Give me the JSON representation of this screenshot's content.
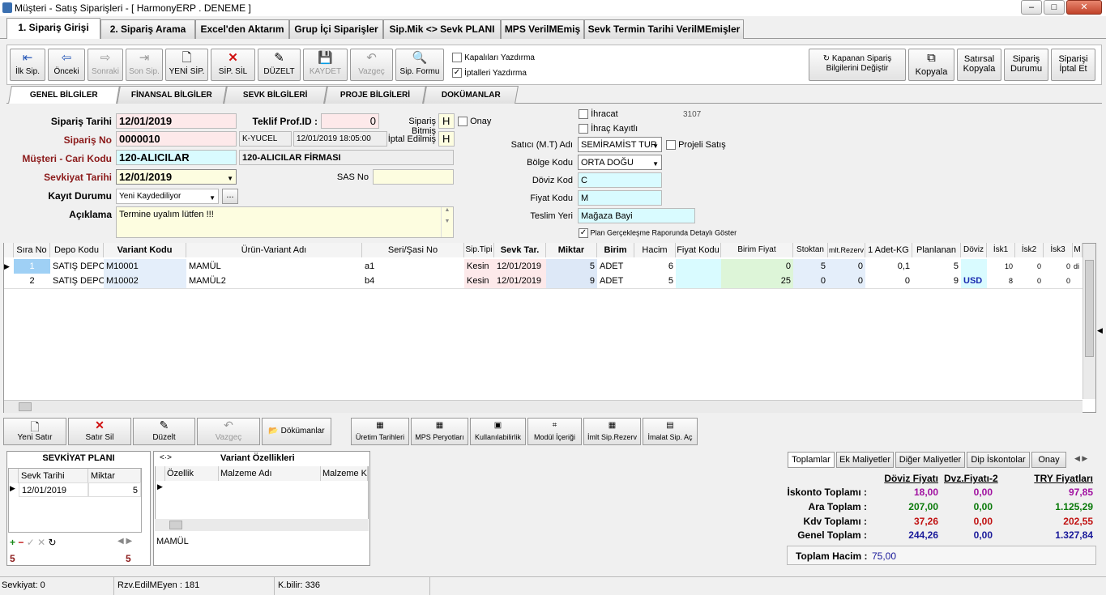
{
  "window": {
    "title": "Müşteri - Satış Siparişleri - [ HarmonyERP . DENEME ]",
    "min": "–",
    "max": "□",
    "close": "✕"
  },
  "main_tabs": [
    "1. Sipariş Girişi",
    "2. Sipariş Arama",
    "Excel'den Aktarım",
    "Grup İçi Siparişler",
    "Sip.Mik <> Sevk PLANI",
    "MPS VerilMEmiş",
    "Sevk Termin Tarihi VerilMEmişler"
  ],
  "toolbar": {
    "first": "İlk Sip.",
    "prev": "Önceki",
    "next": "Sonraki",
    "last": "Son Sip.",
    "new": "YENİ SİP.",
    "delete": "SİP. SİL",
    "edit": "DÜZELT",
    "save": "KAYDET",
    "cancel": "Vazgeç",
    "form": "Sip. Formu",
    "print_closed": "Kapalıları Yazdırma",
    "print_cancelled": "İptalleri Yazdırma",
    "change_closed": "Kapanan Sipariş Bilgilerini Değiştir",
    "copy": "Kopyala",
    "row_copy": "Satırsal Kopyala",
    "order_status": "Sipariş Durumu",
    "cancel_order": "Siparişi İptal Et"
  },
  "sub_tabs": [
    "GENEL BİLGİLER",
    "FİNANSAL BİLGİLER",
    "SEVK BİLGİLERİ",
    "PROJE BİLGİLERİ",
    "DOKÜMANLAR"
  ],
  "form": {
    "order_date_label": "Sipariş Tarihi",
    "order_date": "12/01/2019",
    "order_no_label": "Sipariş No",
    "order_no": "0000010",
    "customer_label": "Müşteri - Cari Kodu",
    "customer_code": "120-ALICILAR",
    "customer_name": "120-ALICILAR FİRMASI",
    "ship_date_label": "Sevkiyat Tarihi",
    "ship_date": "12/01/2019",
    "record_status_label": "Kayıt Durumu",
    "record_status": "Yeni Kaydediliyor",
    "note_label": "Açıklama",
    "note": "Termine uyalım lütfen !!!",
    "offer_label": "Teklif Prof.ID :",
    "offer_id": "0",
    "user": "K-YUCEL",
    "timestamp": "12/01/2019 18:05:00",
    "finished_label": "Sipariş Bitmiş",
    "finished": "H",
    "cancelled_label": "İptal Edilmiş",
    "cancelled": "H",
    "approve_label": "Onay",
    "sas_label": "SAS No",
    "export_label": "İhracat",
    "export_reg_label": "İhraç Kayıtlı",
    "code_3107": "3107",
    "seller_label": "Satıcı (M.T) Adı",
    "seller": "SEMİRAMİST TUR",
    "project_sale_label": "Projeli Satış",
    "region_label": "Bölge Kodu",
    "region": "ORTA DOĞU",
    "currency_label": "Döviz Kod",
    "currency": "C",
    "price_label": "Fiyat Kodu",
    "price": "M",
    "delivery_label": "Teslim Yeri",
    "delivery": "Mağaza Bayi",
    "plan_label": "Plan Gerçekleşme Raporunda Detaylı Göster"
  },
  "grid": {
    "headers": [
      "Sıra No",
      "Depo Kodu",
      "Variant Kodu",
      "Ürün-Variant Adı",
      "Seri/Şasi No",
      "Sip.Tipi",
      "Sevk Tar.",
      "Miktar",
      "Birim",
      "Hacim",
      "Fiyat Kodu",
      "Birim Fiyat",
      "Stoktan",
      "mlt.Rezerv",
      "1 Adet-KG",
      "Planlanan",
      "Döviz",
      "İsk1",
      "İsk2",
      "İsk3",
      "M"
    ],
    "rows": [
      [
        "1",
        "SATIŞ DEPO",
        "M10001",
        "MAMÜL",
        "a1",
        "Kesin",
        "12/01/2019",
        "5",
        "ADET",
        "6",
        "",
        "0",
        "5",
        "0",
        "0,1",
        "5",
        "",
        "10",
        "0",
        "0",
        "di"
      ],
      [
        "2",
        "SATIŞ DEPO",
        "M10002",
        "MAMÜL2",
        "b4",
        "Kesin",
        "12/01/2019",
        "9",
        "ADET",
        "5",
        "",
        "25",
        "0",
        "0",
        "0",
        "9",
        "USD",
        "8",
        "0",
        "0",
        ""
      ]
    ]
  },
  "bottom_buttons": [
    "Yeni Satır",
    "Satır Sil",
    "Düzelt",
    "Vazgeç",
    "Dökümanlar",
    "Üretim Tarihleri",
    "MPS Peryotları",
    "Kullanılabilirlik",
    "Modül İçeriği",
    "İmlt Sip.Rezerv",
    "İmalat Sip. Aç"
  ],
  "ship_plan": {
    "title": "SEVKİYAT PLANI",
    "col_date": "Sevk Tarihi",
    "col_qty": "Miktar",
    "date": "12/01/2019",
    "qty": "5",
    "count_left": "5",
    "count_right": "5"
  },
  "variant": {
    "title": "Variant Özellikleri",
    "nav": "<·>",
    "col1": "Özellik",
    "col2": "Malzeme Adı",
    "col3": "Malzeme Ko",
    "product": "MAMÜL"
  },
  "totals": {
    "tabs": [
      "Toplamlar",
      "Ek Maliyetler",
      "Diğer Maliyetler",
      "Dip İskontolar",
      "Onay"
    ],
    "col_fx": "Döviz Fiyatı",
    "col_fx2": "Dvz.Fiyatı-2",
    "col_try": "TRY Fiyatları",
    "rows": [
      {
        "label": "İskonto Toplamı :",
        "fx": "18,00",
        "fx2": "0,00",
        "try": "97,85"
      },
      {
        "label": "Ara Toplam :",
        "fx": "207,00",
        "fx2": "0,00",
        "try": "1.125,29"
      },
      {
        "label": "Kdv Toplamı :",
        "fx": "37,26",
        "fx2": "0,00",
        "try": "202,55"
      },
      {
        "label": "Genel Toplam :",
        "fx": "244,26",
        "fx2": "0,00",
        "try": "1.327,84"
      }
    ],
    "volume_label": "Toplam Hacim :",
    "volume": "75,00"
  },
  "status": {
    "ship": "Sevkiyat: 0",
    "rzv": "Rzv.EdilMEyen : 181",
    "kbilir": "K.bilir: 336"
  }
}
